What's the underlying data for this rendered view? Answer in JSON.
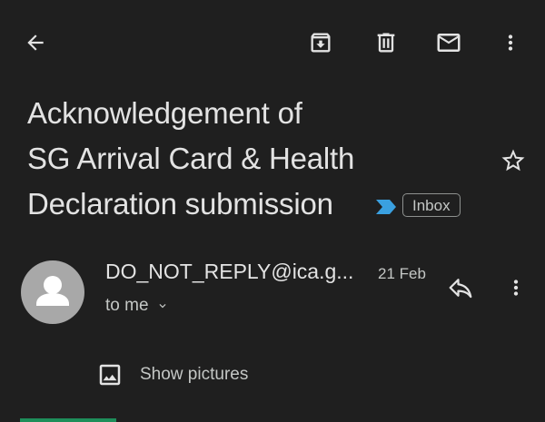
{
  "toolbar": {
    "back_icon": "arrow-back-icon",
    "archive_icon": "archive-icon",
    "delete_icon": "trash-icon",
    "mark_unread_icon": "mail-icon",
    "more_icon": "more-vert-icon"
  },
  "email": {
    "subject_lines": [
      "Acknowledgement of",
      "SG Arrival Card & Health",
      "Declaration submission"
    ],
    "label": "Inbox",
    "star_icon": "star-outline-icon",
    "importance_icon": "importance-marker-icon",
    "sender": "DO_NOT_REPLY@ica.g...",
    "date": "21 Feb",
    "recipient": "to me",
    "show_pictures": "Show pictures"
  },
  "colors": {
    "background": "#1f1f1f",
    "text": "#e3e3e3",
    "secondary_text": "#c4c7c5",
    "importance": "#3aa0e0",
    "avatar": "#a8a8a8"
  }
}
